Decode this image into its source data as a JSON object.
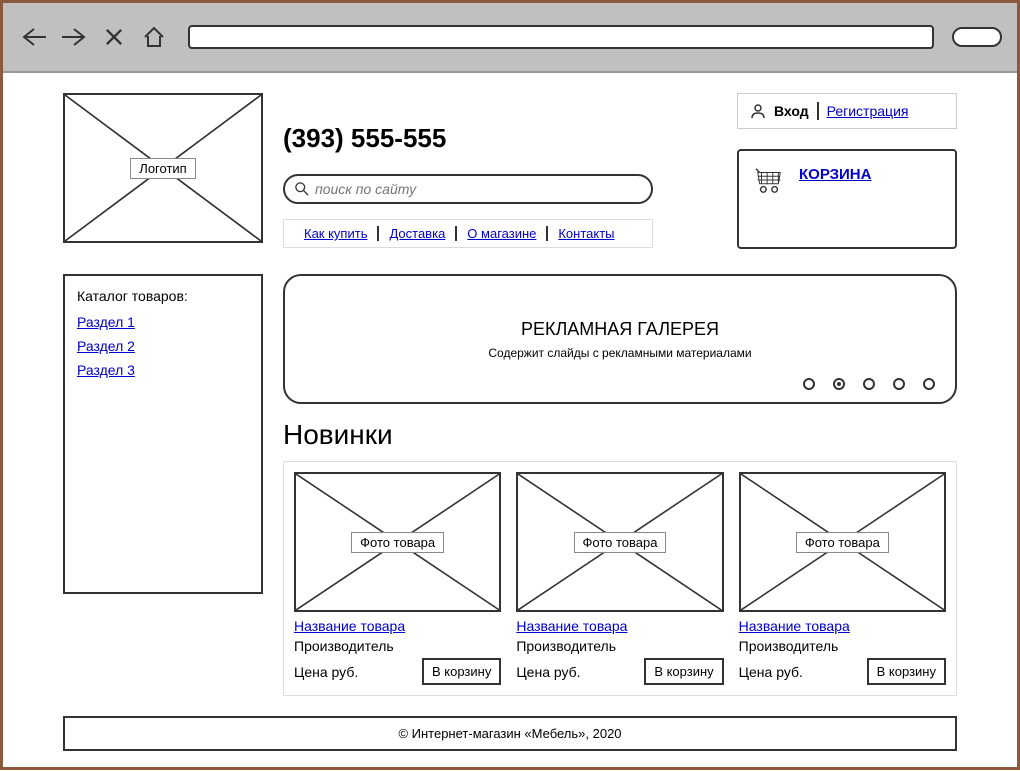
{
  "logo": {
    "label": "Логотип"
  },
  "phone": "(393) 555-555",
  "search": {
    "placeholder": "поиск по сайту"
  },
  "info_links": [
    "Как купить",
    "Доставка",
    "О магазине",
    "Контакты"
  ],
  "auth": {
    "login": "Вход",
    "register": "Регистрация"
  },
  "cart": {
    "label": "КОРЗИНА"
  },
  "catalog": {
    "title": "Каталог товаров:",
    "items": [
      "Раздел 1",
      "Раздел 2",
      "Раздел 3"
    ]
  },
  "gallery": {
    "title": "РЕКЛАМНАЯ ГАЛЕРЕЯ",
    "subtitle": "Содержит слайды с рекламными материалами",
    "active_dot": 1
  },
  "novelties": {
    "title": "Новинки",
    "products": [
      {
        "img_label": "Фото товара",
        "name": "Название товара",
        "maker": "Производитель",
        "price": "Цена руб.",
        "btn": "В корзину"
      },
      {
        "img_label": "Фото товара",
        "name": "Название товара",
        "maker": "Производитель",
        "price": "Цена руб.",
        "btn": "В корзину"
      },
      {
        "img_label": "Фото товара",
        "name": "Название товара",
        "maker": "Производитель",
        "price": "Цена руб.",
        "btn": "В корзину"
      }
    ]
  },
  "footer": "© Интернет-магазин «Мебель», 2020"
}
